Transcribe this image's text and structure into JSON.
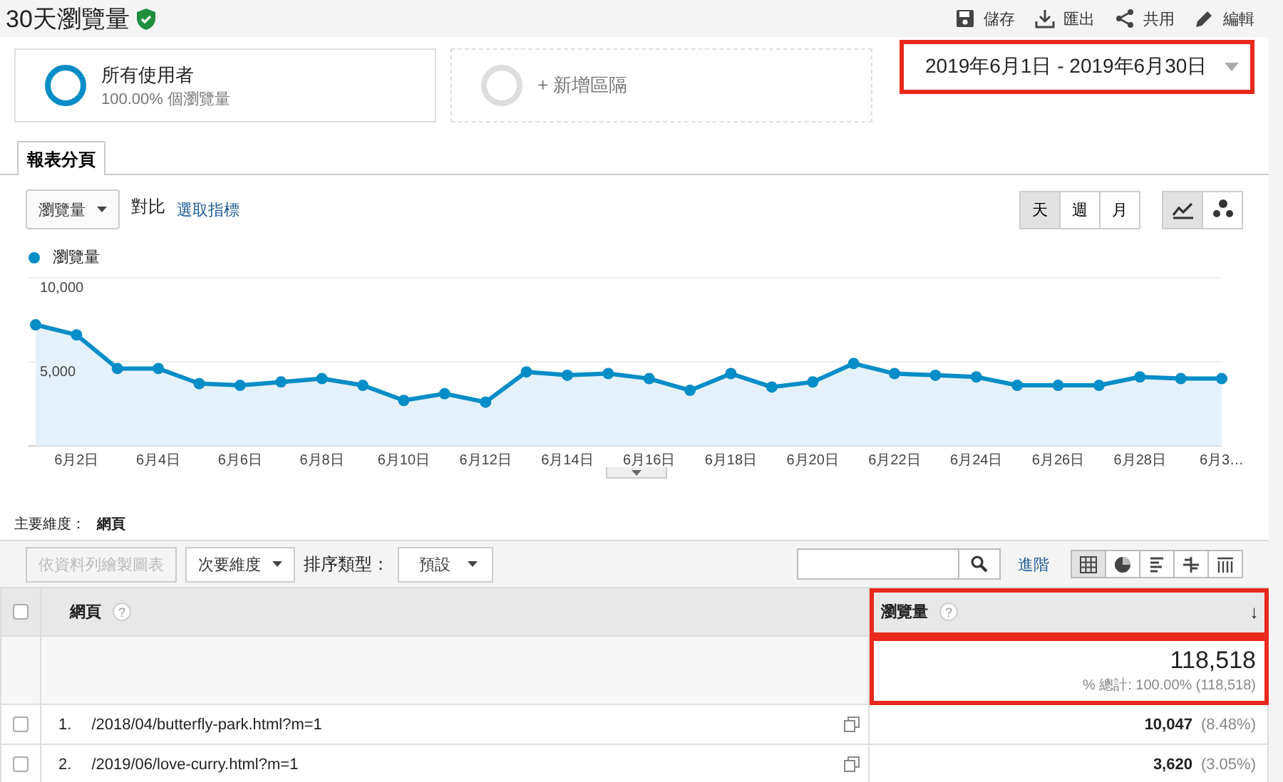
{
  "header": {
    "title": "30天瀏覽量",
    "actions": [
      {
        "kind": "save",
        "label": "儲存"
      },
      {
        "kind": "export",
        "label": "匯出"
      },
      {
        "kind": "share",
        "label": "共用"
      },
      {
        "kind": "edit",
        "label": "編輯"
      }
    ]
  },
  "segments": [
    {
      "kind": "active",
      "label": "所有使用者",
      "sub": "100.00% 個瀏覽量"
    },
    {
      "kind": "add",
      "label": "+ 新增區隔"
    }
  ],
  "date_range": "2019年6月1日 - 2019年6月30日",
  "tabs": [
    {
      "label": "報表分頁",
      "selected": true
    }
  ],
  "metric_dropdown": "瀏覽量",
  "compare_label": "對比",
  "pick_metric_link": "選取指標",
  "granularity": [
    {
      "label": "天",
      "selected": true
    },
    {
      "label": "週",
      "selected": false
    },
    {
      "label": "月",
      "selected": false
    }
  ],
  "chart_types": [
    {
      "kind": "line",
      "selected": true
    },
    {
      "kind": "motion",
      "selected": false
    }
  ],
  "chart": {
    "chart_data": {
      "type": "area",
      "categories": [
        null,
        "6月2日",
        null,
        "6月4日",
        null,
        "6月6日",
        null,
        "6月8日",
        null,
        "6月10日",
        null,
        "6月12日",
        null,
        "6月14日",
        null,
        "6月16日",
        null,
        "6月18日",
        null,
        "6月20日",
        null,
        "6月22日",
        null,
        "6月24日",
        null,
        "6月26日",
        null,
        "6月28日",
        null,
        "6月3…"
      ],
      "series": [
        {
          "name": "瀏覽量",
          "color": "#058dc7",
          "values": [
            7200,
            6600,
            4600,
            4600,
            3700,
            3600,
            3800,
            4000,
            3600,
            2700,
            3100,
            2600,
            4400,
            4200,
            4300,
            4000,
            3300,
            4300,
            3500,
            3800,
            4900,
            4300,
            4200,
            4100,
            3600,
            3600,
            3600,
            4100,
            4000,
            4000
          ]
        }
      ],
      "ylim": [
        0,
        10000
      ],
      "yticks": [
        {
          "value": 5000,
          "label": "5,000"
        },
        {
          "value": 10000,
          "label": "10,000"
        }
      ]
    }
  },
  "primary_dimension": {
    "label": "主要維度：",
    "value": "網頁"
  },
  "table_toolbar": {
    "plot_rows_button": {
      "label": "依資料列繪製圖表",
      "disabled": true
    },
    "secondary_dimension": "次要維度",
    "sort_label": "排序類型：",
    "sort_value": "預設",
    "advanced_link": "進階",
    "views": [
      {
        "kind": "table",
        "selected": true
      },
      {
        "kind": "pie",
        "selected": false
      },
      {
        "kind": "performance",
        "selected": false
      },
      {
        "kind": "comparison",
        "selected": false
      },
      {
        "kind": "pivot",
        "selected": false
      }
    ]
  },
  "table": {
    "select_all_checked": false,
    "columns": [
      {
        "label": "網頁",
        "help": "?"
      },
      {
        "label": "瀏覽量",
        "help": "?",
        "sort_indicator": "↓"
      }
    ],
    "totals": {
      "value": "118,518",
      "share": "% 總計: 100.00% (118,518)"
    },
    "rows": [
      {
        "index": "1.",
        "page": "/2018/04/butterfly-park.html?m=1",
        "views": "10,047",
        "percent": "(8.48%)",
        "checked": false
      },
      {
        "index": "2.",
        "page": "/2019/06/love-curry.html?m=1",
        "views": "3,620",
        "percent": "(3.05%)",
        "checked": false
      }
    ]
  }
}
